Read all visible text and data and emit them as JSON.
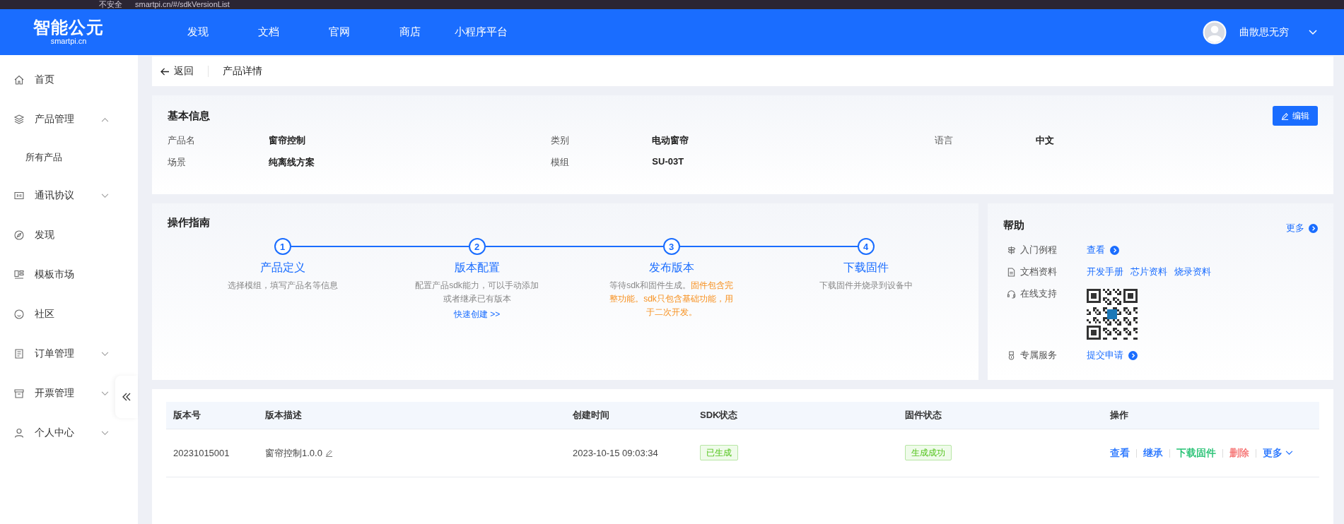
{
  "browser": {
    "security": "不安全",
    "url": "smartpi.cn/#/sdkVersionList"
  },
  "header": {
    "logo": "智能公元",
    "logo_sub": "smartpi.cn",
    "nav": [
      "发现",
      "文档",
      "官网",
      "商店",
      "小程序平台"
    ],
    "user": "曲散思无穷"
  },
  "sidebar": {
    "items": [
      {
        "label": "首页"
      },
      {
        "label": "产品管理",
        "expanded": true,
        "children": [
          {
            "label": "所有产品"
          }
        ]
      },
      {
        "label": "通讯协议",
        "expanded": false
      },
      {
        "label": "发现"
      },
      {
        "label": "模板市场"
      },
      {
        "label": "社区"
      },
      {
        "label": "订单管理",
        "expanded": false
      },
      {
        "label": "开票管理",
        "expanded": false
      },
      {
        "label": "个人中心",
        "expanded": false
      }
    ]
  },
  "breadcrumb": {
    "back": "返回",
    "title": "产品详情"
  },
  "basic_info": {
    "title": "基本信息",
    "edit": "编辑",
    "fields": [
      {
        "label": "产品名",
        "value": "窗帘控制"
      },
      {
        "label": "类别",
        "value": "电动窗帘"
      },
      {
        "label": "语言",
        "value": "中文"
      },
      {
        "label": "场景",
        "value": "纯离线方案"
      },
      {
        "label": "模组",
        "value": "SU-03T"
      }
    ]
  },
  "guide": {
    "title": "操作指南",
    "steps": [
      {
        "number": "1",
        "title": "产品定义",
        "desc": "选择模组，填写产品名等信息"
      },
      {
        "number": "2",
        "title": "版本配置",
        "desc": "配置产品sdk能力，可以手动添加或者继承已有版本",
        "link": "快速创建 >>"
      },
      {
        "number": "3",
        "title": "发布版本",
        "desc": "等待sdk和固件生成。",
        "note": "固件包含完整功能。sdk只包含基础功能，用于二次开发。"
      },
      {
        "number": "4",
        "title": "下载固件",
        "desc": "下载固件并烧录到设备中"
      }
    ]
  },
  "help": {
    "title": "帮助",
    "more": "更多",
    "rows": [
      {
        "label": "入门例程",
        "kind": "links",
        "links": [
          {
            "text": "查看",
            "arrow": true
          }
        ]
      },
      {
        "label": "文档资料",
        "kind": "links",
        "links": [
          {
            "text": "开发手册",
            "arrow": false
          },
          {
            "text": "芯片资料",
            "arrow": false
          },
          {
            "text": "烧录资料",
            "arrow": false
          }
        ]
      },
      {
        "label": "在线支持",
        "kind": "qr"
      },
      {
        "label": "专属服务",
        "kind": "links",
        "links": [
          {
            "text": "提交申请",
            "arrow": true
          }
        ]
      }
    ]
  },
  "table": {
    "columns": [
      "版本号",
      "版本描述",
      "创建时间",
      "SDK状态",
      "固件状态",
      "操作"
    ],
    "rows": [
      {
        "version": "20231015001",
        "desc": "窗帘控制1.0.0",
        "created": "2023-10-15 09:03:34",
        "sdk_status": "已生成",
        "fw_status": "生成成功",
        "actions": [
          {
            "text": "查看",
            "color": "#1a6dff"
          },
          {
            "text": "继承",
            "color": "#1a6dff"
          },
          {
            "text": "下载固件",
            "color": "#19be6b"
          },
          {
            "text": "删除",
            "color": "#f56c6c"
          },
          {
            "text": "更多",
            "color": "#1a6dff",
            "caret": true
          }
        ]
      }
    ]
  }
}
